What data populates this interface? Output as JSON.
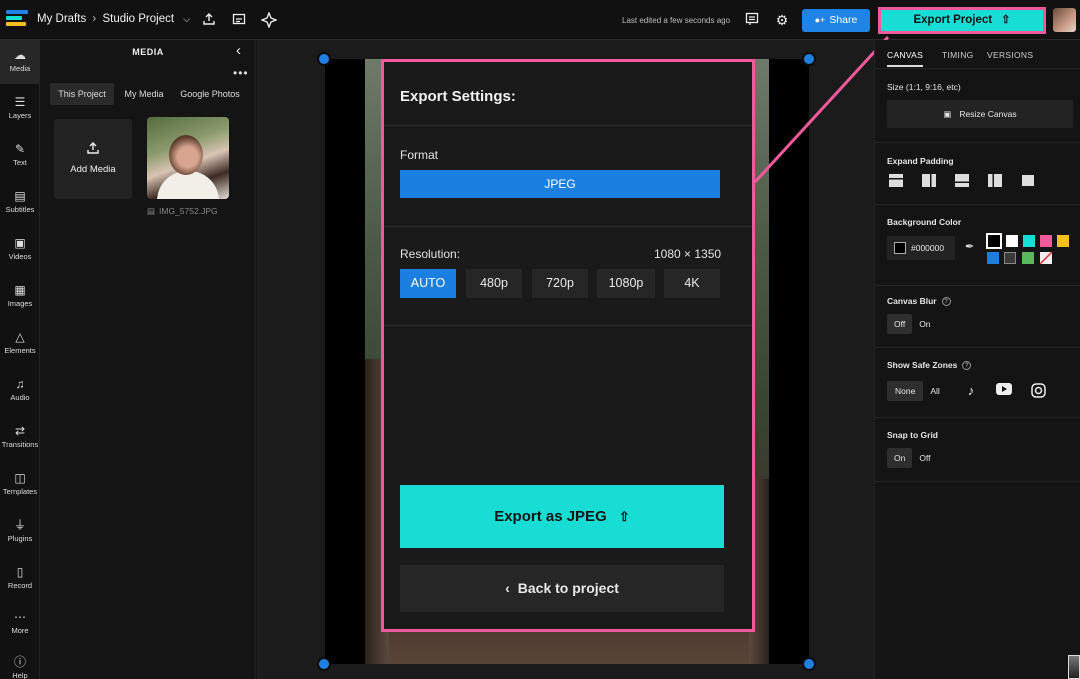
{
  "topbar": {
    "breadcrumb_parent": "My Drafts",
    "breadcrumb_sep": "›",
    "project_name": "Studio Project",
    "last_edited": "Last edited a few seconds ago",
    "share_label": "Share",
    "export_label": "Export Project",
    "logo_colors": [
      "#1f84e6",
      "#17ddd5",
      "#f2c021",
      "#f05a9b"
    ]
  },
  "leftnav": {
    "items": [
      {
        "label": "Media",
        "icon": "upload-cloud-icon"
      },
      {
        "label": "Layers",
        "icon": "layers-icon"
      },
      {
        "label": "Text",
        "icon": "text-edit-icon"
      },
      {
        "label": "Subtitles",
        "icon": "subtitles-icon"
      },
      {
        "label": "Videos",
        "icon": "film-icon"
      },
      {
        "label": "Images",
        "icon": "image-icon"
      },
      {
        "label": "Elements",
        "icon": "shapes-icon"
      },
      {
        "label": "Audio",
        "icon": "music-note-icon"
      },
      {
        "label": "Transitions",
        "icon": "transition-icon"
      },
      {
        "label": "Templates",
        "icon": "grid-icon"
      },
      {
        "label": "Plugins",
        "icon": "plug-icon"
      },
      {
        "label": "Record",
        "icon": "record-icon"
      },
      {
        "label": "More",
        "icon": "more-dots-icon"
      },
      {
        "label": "Help",
        "icon": "help-circle-icon"
      }
    ]
  },
  "media": {
    "title": "MEDIA",
    "tabs": [
      "This Project",
      "My Media",
      "Google Photos"
    ],
    "add_media_label": "Add Media",
    "file_name": "IMG_5752.JPG"
  },
  "export_dialog": {
    "title": "Export Settings:",
    "format_label": "Format",
    "format_value": "JPEG",
    "resolution_label": "Resolution:",
    "resolution_dims": "1080 × 1350",
    "resolution_options": [
      "AUTO",
      "480p",
      "720p",
      "1080p",
      "4K"
    ],
    "resolution_selected": "AUTO",
    "export_button": "Export as JPEG",
    "back_button": "Back to project"
  },
  "rightpanel": {
    "tabs": [
      "CANVAS",
      "TIMING",
      "VERSIONS"
    ],
    "size_label": "Size (1:1, 9:16, etc)",
    "resize_label": "Resize Canvas",
    "expand_padding_label": "Expand Padding",
    "bg_color_label": "Background Color",
    "bg_color_value": "#000000",
    "swatches": [
      "#000000",
      "#ffffff",
      "#17ddd5",
      "#f05a9b",
      "#f2c021",
      "#1a7fe0",
      "#3a3a3a",
      "#5cb85c",
      "none"
    ],
    "canvas_blur_label": "Canvas Blur",
    "canvas_blur_options": [
      "Off",
      "On"
    ],
    "safe_zones_label": "Show Safe Zones",
    "safe_zones_options": [
      "None",
      "All"
    ],
    "snap_label": "Snap to Grid",
    "snap_options": [
      "On",
      "Off"
    ]
  }
}
